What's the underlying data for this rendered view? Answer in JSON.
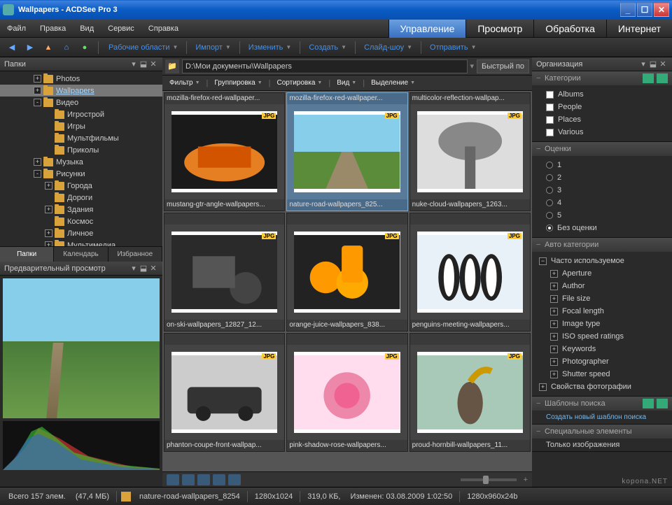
{
  "window": {
    "title": "Wallpapers - ACDSee Pro 3"
  },
  "menu": [
    "Файл",
    "Правка",
    "Вид",
    "Сервис",
    "Справка"
  ],
  "modes": {
    "items": [
      "Управление",
      "Просмотр",
      "Обработка",
      "Интернет"
    ],
    "active": 0
  },
  "toolbar": [
    "Рабочие области",
    "Импорт",
    "Изменить",
    "Создать",
    "Слайд-шоу",
    "Отправить"
  ],
  "folders": {
    "title": "Папки",
    "tree": [
      {
        "depth": 3,
        "exp": "+",
        "label": "Photos"
      },
      {
        "depth": 3,
        "exp": "+",
        "label": "Wallpapers",
        "sel": true
      },
      {
        "depth": 3,
        "exp": "-",
        "label": "Видео"
      },
      {
        "depth": 4,
        "exp": "",
        "label": "Игрострой"
      },
      {
        "depth": 4,
        "exp": "",
        "label": "Игры"
      },
      {
        "depth": 4,
        "exp": "",
        "label": "Мультфильмы"
      },
      {
        "depth": 4,
        "exp": "",
        "label": "Приколы"
      },
      {
        "depth": 3,
        "exp": "+",
        "label": "Музыка"
      },
      {
        "depth": 3,
        "exp": "-",
        "label": "Рисунки"
      },
      {
        "depth": 4,
        "exp": "+",
        "label": "Города"
      },
      {
        "depth": 4,
        "exp": "",
        "label": "Дороги"
      },
      {
        "depth": 4,
        "exp": "+",
        "label": "Здания"
      },
      {
        "depth": 4,
        "exp": "",
        "label": "Космос"
      },
      {
        "depth": 4,
        "exp": "+",
        "label": "Личное"
      },
      {
        "depth": 4,
        "exp": "+",
        "label": "Мультимедиа"
      }
    ]
  },
  "lefttabs": {
    "items": [
      "Папки",
      "Календарь",
      "Избранное"
    ],
    "active": 0
  },
  "preview": {
    "title": "Предварительный просмотр"
  },
  "path": {
    "value": "D:\\Мои документы\\Wallpapers",
    "quick": "Быстрый по"
  },
  "filterbar": [
    "Фильтр",
    "Группировка",
    "Сортировка",
    "Вид",
    "Выделение"
  ],
  "thumbs": [
    {
      "top": "mozilla-firefox-red-wallpaper...",
      "bot": "mustang-gtr-angle-wallpapers..."
    },
    {
      "top": "mozilla-firefox-red-wallpaper...",
      "bot": "nature-road-wallpapers_825...",
      "sel": true
    },
    {
      "top": "multicolor-reflection-wallpap...",
      "bot": "nuke-cloud-wallpapers_1263..."
    },
    {
      "top": "",
      "bot": "on-ski-wallpapers_12827_12..."
    },
    {
      "top": "",
      "bot": "orange-juice-wallpapers_838..."
    },
    {
      "top": "",
      "bot": "penguins-meeting-wallpapers..."
    },
    {
      "top": "",
      "bot": "phanton-coupe-front-wallpap..."
    },
    {
      "top": "",
      "bot": "pink-shadow-rose-wallpapers..."
    },
    {
      "top": "",
      "bot": "proud-hornbill-wallpapers_11..."
    }
  ],
  "org": {
    "title": "Организация",
    "categories": {
      "label": "Категории",
      "items": [
        "Albums",
        "People",
        "Places",
        "Various"
      ]
    },
    "ratings": {
      "label": "Оценки",
      "items": [
        "1",
        "2",
        "3",
        "4",
        "5",
        "Без оценки"
      ],
      "selected": 5
    },
    "autocat": {
      "label": "Авто категории",
      "freq": {
        "label": "Часто используемое",
        "items": [
          "Aperture",
          "Author",
          "File size",
          "Focal length",
          "Image type",
          "ISO speed ratings",
          "Keywords",
          "Photographer",
          "Shutter speed"
        ]
      },
      "photo_props": "Свойства фотографии"
    },
    "templates": {
      "label": "Шаблоны поиска",
      "new": "Создать новый шаблон поиска"
    },
    "special": {
      "label": "Специальные элементы",
      "only_images": "Только изображения"
    }
  },
  "status": {
    "total": "Всего 157 элем.",
    "size": "(47,4 МБ)",
    "file": "nature-road-wallpapers_8254",
    "dims": "1280x1024",
    "filesize": "319,0 КБ,",
    "modified": "Изменен: 03.08.2009 1:02:50",
    "mode": "1280x960x24b"
  },
  "watermark": "kopona.NET"
}
